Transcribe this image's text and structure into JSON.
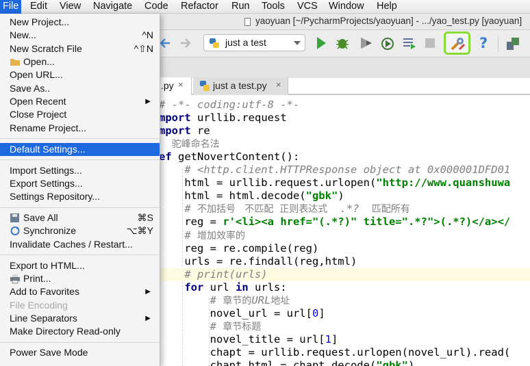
{
  "menubar": {
    "items": [
      "File",
      "Edit",
      "View",
      "Navigate",
      "Code",
      "Refactor",
      "Run",
      "Tools",
      "VCS",
      "Window",
      "Help"
    ]
  },
  "window": {
    "title": "yaoyuan [~/PycharmProjects/yaoyuan] - .../yao_test.py [yaoyuan]"
  },
  "toolbar": {
    "run_config": "just a test",
    "colors": {
      "run": "#3aa53a",
      "debug": "#4a8c2a",
      "help": "#3b7bd6",
      "sdk_highlight": "#88dd33"
    }
  },
  "tabs": [
    {
      "label": ".py",
      "close": "×",
      "active": true
    },
    {
      "label": "just a test.py",
      "close": "×",
      "active": false
    }
  ],
  "editor": {
    "lines": [
      {
        "parts": [
          {
            "t": "# -*- coding:utf-8 -*-",
            "c": "cmt"
          }
        ]
      },
      {
        "parts": [
          {
            "t": "mport",
            "c": "kw"
          },
          {
            "t": " urllib.request",
            "c": ""
          }
        ]
      },
      {
        "parts": [
          {
            "t": "mport",
            "c": "kw"
          },
          {
            "t": " re",
            "c": ""
          }
        ]
      },
      {
        "parts": [
          {
            "t": "  ",
            "c": ""
          },
          {
            "t": "驼峰命名法",
            "c": "cmt-cn"
          }
        ]
      },
      {
        "parts": [
          {
            "t": "ef",
            "c": "kw"
          },
          {
            "t": " getNovertContent():",
            "c": ""
          }
        ]
      },
      {
        "parts": [
          {
            "t": "    ",
            "c": ""
          },
          {
            "t": "# <http.client.HTTPResponse object at 0x000001DFD01",
            "c": "cmt"
          }
        ]
      },
      {
        "parts": [
          {
            "t": "    html = urllib.request.urlopen(",
            "c": ""
          },
          {
            "t": "\"http://www.quanshuwa",
            "c": "str"
          }
        ]
      },
      {
        "parts": [
          {
            "t": "    html = html.decode(",
            "c": ""
          },
          {
            "t": "\"gbk\"",
            "c": "str"
          },
          {
            "t": ")",
            "c": ""
          }
        ]
      },
      {
        "parts": [
          {
            "t": "    # ",
            "c": "cmt"
          },
          {
            "t": "不加括号   不匹配  正则表达式  ",
            "c": "cmt-cn"
          },
          {
            "t": " .*? ",
            "c": "cmt"
          },
          {
            "t": "  匹配所有",
            "c": "cmt-cn"
          }
        ]
      },
      {
        "parts": [
          {
            "t": "    reg = ",
            "c": ""
          },
          {
            "t": "r'<li><a href=\"(.*?)\" title=\".*?\">(.*?)</a></",
            "c": "str"
          }
        ]
      },
      {
        "parts": [
          {
            "t": "    # ",
            "c": "cmt"
          },
          {
            "t": "增加效率的",
            "c": "cmt-cn"
          }
        ]
      },
      {
        "parts": [
          {
            "t": "    reg = re.compile(reg)",
            "c": ""
          }
        ]
      },
      {
        "parts": [
          {
            "t": "    urls = re.findall(reg,html)",
            "c": ""
          }
        ]
      },
      {
        "parts": [
          {
            "t": "    ",
            "c": ""
          },
          {
            "t": "# print(urls)",
            "c": "cmt"
          }
        ],
        "highlight": true
      },
      {
        "parts": [
          {
            "t": "    ",
            "c": ""
          },
          {
            "t": "for",
            "c": "kw"
          },
          {
            "t": " url ",
            "c": ""
          },
          {
            "t": "in",
            "c": "kw"
          },
          {
            "t": " urls:",
            "c": ""
          }
        ]
      },
      {
        "parts": [
          {
            "t": "        # ",
            "c": "cmt"
          },
          {
            "t": "章节的",
            "c": "cmt-cn"
          },
          {
            "t": "URL",
            "c": "cmt"
          },
          {
            "t": "地址",
            "c": "cmt-cn"
          }
        ]
      },
      {
        "parts": [
          {
            "t": "        novel_url = url[",
            "c": ""
          },
          {
            "t": "0",
            "c": "num"
          },
          {
            "t": "]",
            "c": ""
          }
        ]
      },
      {
        "parts": [
          {
            "t": "        # ",
            "c": "cmt"
          },
          {
            "t": "章节标题",
            "c": "cmt-cn"
          }
        ]
      },
      {
        "parts": [
          {
            "t": "        novel_title = url[",
            "c": ""
          },
          {
            "t": "1",
            "c": "num"
          },
          {
            "t": "]",
            "c": ""
          }
        ]
      },
      {
        "parts": [
          {
            "t": "        chapt = urllib.request.urlopen(novel_url).read(",
            "c": ""
          }
        ]
      },
      {
        "parts": [
          {
            "t": "        chapt_html = chapt.decode(",
            "c": ""
          },
          {
            "t": "\"gbk\"",
            "c": "str"
          },
          {
            "t": ")",
            "c": ""
          }
        ]
      }
    ]
  },
  "file_menu": {
    "items": [
      {
        "label": "New Project...",
        "shortcut": ""
      },
      {
        "label": "New...",
        "shortcut": "^N"
      },
      {
        "label": "New Scratch File",
        "shortcut": "^⇧N"
      },
      {
        "label": "Open...",
        "shortcut": "",
        "icon": "folder-icon"
      },
      {
        "label": "Open URL...",
        "shortcut": ""
      },
      {
        "label": "Save As..",
        "shortcut": ""
      },
      {
        "label": "Open Recent",
        "shortcut": "",
        "submenu": true
      },
      {
        "label": "Close Project",
        "shortcut": ""
      },
      {
        "label": "Rename Project...",
        "shortcut": ""
      },
      {
        "separator": true
      },
      {
        "label": "Default Settings...",
        "shortcut": "",
        "selected": true
      },
      {
        "separator": true
      },
      {
        "label": "Import Settings...",
        "shortcut": ""
      },
      {
        "label": "Export Settings...",
        "shortcut": ""
      },
      {
        "label": "Settings Repository...",
        "shortcut": ""
      },
      {
        "separator": true
      },
      {
        "label": "Save All",
        "shortcut": "⌘S",
        "icon": "save-icon"
      },
      {
        "label": "Synchronize",
        "shortcut": "⌥⌘Y",
        "icon": "sync-icon"
      },
      {
        "label": "Invalidate Caches / Restart...",
        "shortcut": ""
      },
      {
        "separator": true
      },
      {
        "label": "Export to HTML...",
        "shortcut": ""
      },
      {
        "label": "Print...",
        "shortcut": "",
        "icon": "print-icon"
      },
      {
        "label": "Add to Favorites",
        "shortcut": "",
        "submenu": true
      },
      {
        "label": "File Encoding",
        "shortcut": "",
        "disabled": true
      },
      {
        "label": "Line Separators",
        "shortcut": "",
        "submenu": true
      },
      {
        "label": "Make Directory Read-only",
        "shortcut": ""
      },
      {
        "separator": true
      },
      {
        "label": "Power Save Mode",
        "shortcut": ""
      }
    ],
    "selection_color": "#1f69e0"
  }
}
